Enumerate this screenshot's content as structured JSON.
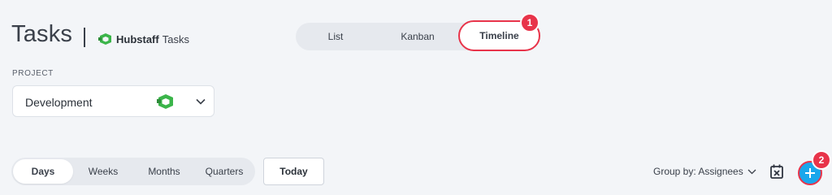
{
  "header": {
    "title": "Tasks",
    "brand_strong": "Hubstaff",
    "brand_light": "Tasks"
  },
  "view_toggle": {
    "items": [
      {
        "label": "List",
        "selected": false
      },
      {
        "label": "Kanban",
        "selected": false
      },
      {
        "label": "Timeline",
        "selected": true
      }
    ],
    "callout_badge": "1"
  },
  "project": {
    "label": "PROJECT",
    "selected_value": "Development",
    "icon": "hubstaff-logo-icon"
  },
  "range_toggle": {
    "items": [
      {
        "label": "Days",
        "selected": true
      },
      {
        "label": "Weeks",
        "selected": false
      },
      {
        "label": "Months",
        "selected": false
      },
      {
        "label": "Quarters",
        "selected": false
      }
    ]
  },
  "toolbar": {
    "today_label": "Today",
    "group_by_label": "Group by: Assignees",
    "calendar_icon": "calendar-close-icon",
    "add_icon": "plus-icon",
    "add_callout_badge": "2"
  },
  "colors": {
    "background": "#f3f5f8",
    "accent_red": "#e8344a",
    "add_blue": "#1aa7ec",
    "logo_green": "#3bb54a"
  }
}
